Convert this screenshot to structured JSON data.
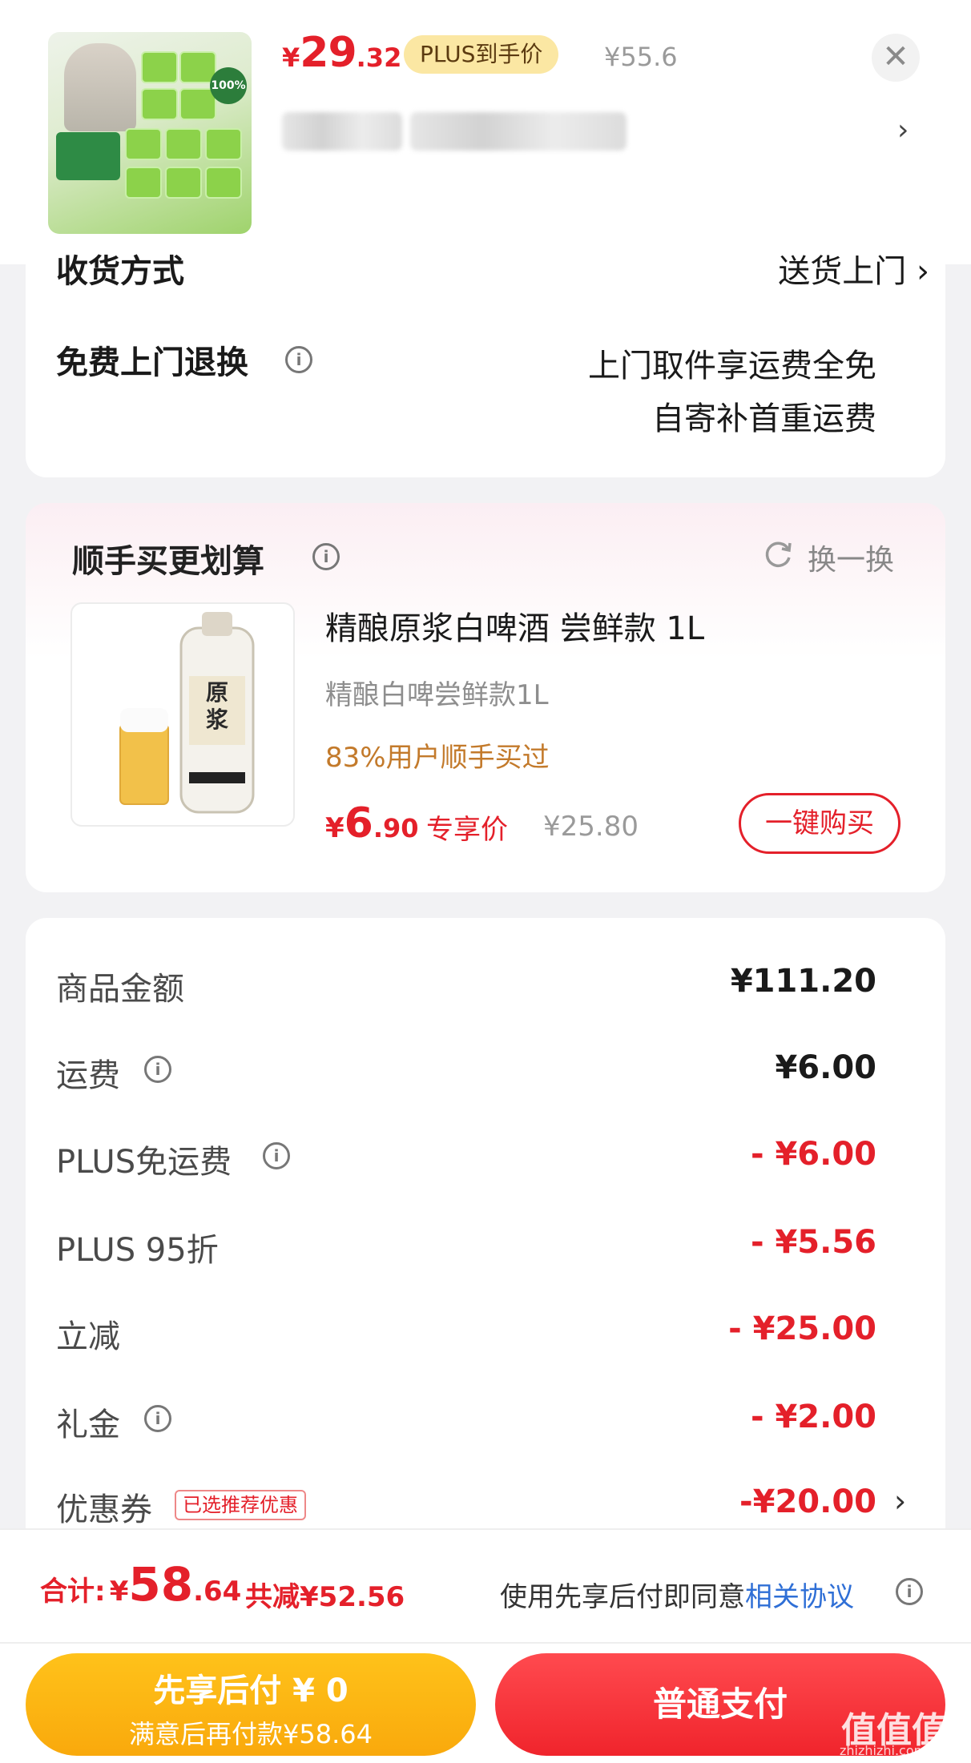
{
  "header": {
    "price_currency": "¥",
    "price_int": "29",
    "price_dec": ".32",
    "plus_label": "PLUS到手价",
    "orig_price": "¥55.6",
    "close_symbol": "✕",
    "chevron": "›"
  },
  "delivery": {
    "label_partial": "收货方式",
    "value_partial": "送货上门 ›"
  },
  "return_service": {
    "label": "免费上门退换",
    "line1": "上门取件享运费全免",
    "line2": "自寄补首重运费"
  },
  "addon": {
    "title": "顺手买更划算",
    "swap_label": "换一换",
    "product": {
      "name": "精酿原浆白啤酒 尝鲜款 1L",
      "sub": "精酿白啤尝鲜款1L",
      "users": "83%用户顺手买过",
      "price_currency": "¥",
      "price_int": "6",
      "price_dec": ".90",
      "exclusive_label": "专享价",
      "orig_price": "¥25.80",
      "buy_button": "一键购买"
    }
  },
  "fees": [
    {
      "label": "商品金额",
      "value": "¥111.20",
      "info": false,
      "red": false
    },
    {
      "label": "运费",
      "value": "¥6.00",
      "info": true,
      "red": false
    },
    {
      "label": "PLUS免运费",
      "value": "- ¥6.00",
      "info": true,
      "red": true
    },
    {
      "label": "PLUS 95折",
      "value": "- ¥5.56",
      "info": false,
      "red": true
    },
    {
      "label": "立减",
      "value": "- ¥25.00",
      "info": false,
      "red": true
    },
    {
      "label": "礼金",
      "value": "- ¥2.00",
      "info": true,
      "red": true
    },
    {
      "label": "优惠券",
      "value": "-¥20.00",
      "info": false,
      "red": true
    }
  ],
  "coupon_tag": "已选推荐优惠",
  "coupon_chevron": "›",
  "footer": {
    "total_label": "合计:",
    "total_currency": "¥",
    "total_int": "58",
    "total_dec": ".64",
    "total_reduce": "共减¥52.56",
    "agree_text": "使用先享后付即同意",
    "agree_link": "相关协议",
    "later_line1": "先享后付 ¥ 0",
    "later_line2": "满意后再付款¥58.64",
    "pay_button": "普通支付"
  },
  "watermark": {
    "main": "值值值",
    "sub": "zhizhizhi.com"
  },
  "colors": {
    "accent_red": "#e4202a",
    "plus_gold": "#fbe7a3",
    "later_yellow": "#f9a90c",
    "link_blue": "#2f6fd6",
    "users_orange": "#c37a2b"
  }
}
